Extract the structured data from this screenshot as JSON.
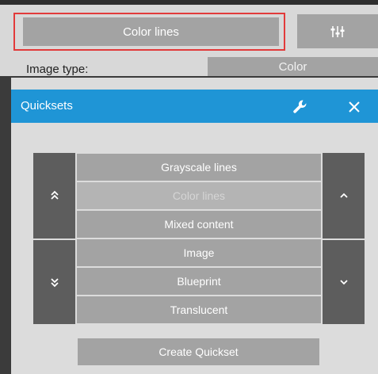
{
  "settings": {
    "quickset_button_label": "Color lines",
    "adjust_icon": "sliders-icon",
    "image_type_label": "Image type:",
    "image_type_value": "Color"
  },
  "dialog": {
    "title": "Quicksets",
    "header_color": "#1f95d6",
    "icons": [
      "wrench-icon",
      "close-icon"
    ],
    "items": [
      {
        "label": "Grayscale lines",
        "selected": false
      },
      {
        "label": "Color lines",
        "selected": true
      },
      {
        "label": "Mixed content",
        "selected": false
      },
      {
        "label": "Image",
        "selected": false
      },
      {
        "label": "Blueprint",
        "selected": false
      },
      {
        "label": "Translucent",
        "selected": false
      }
    ],
    "nav_icons": [
      "double-chevron-up-icon",
      "double-chevron-down-icon",
      "chevron-up-icon",
      "chevron-down-icon"
    ],
    "create_button_label": "Create Quickset"
  },
  "colors": {
    "highlight_border": "#e23a3a",
    "button_gray": "#a3a3a3",
    "arrow_column_gray": "#5d5d5d"
  }
}
